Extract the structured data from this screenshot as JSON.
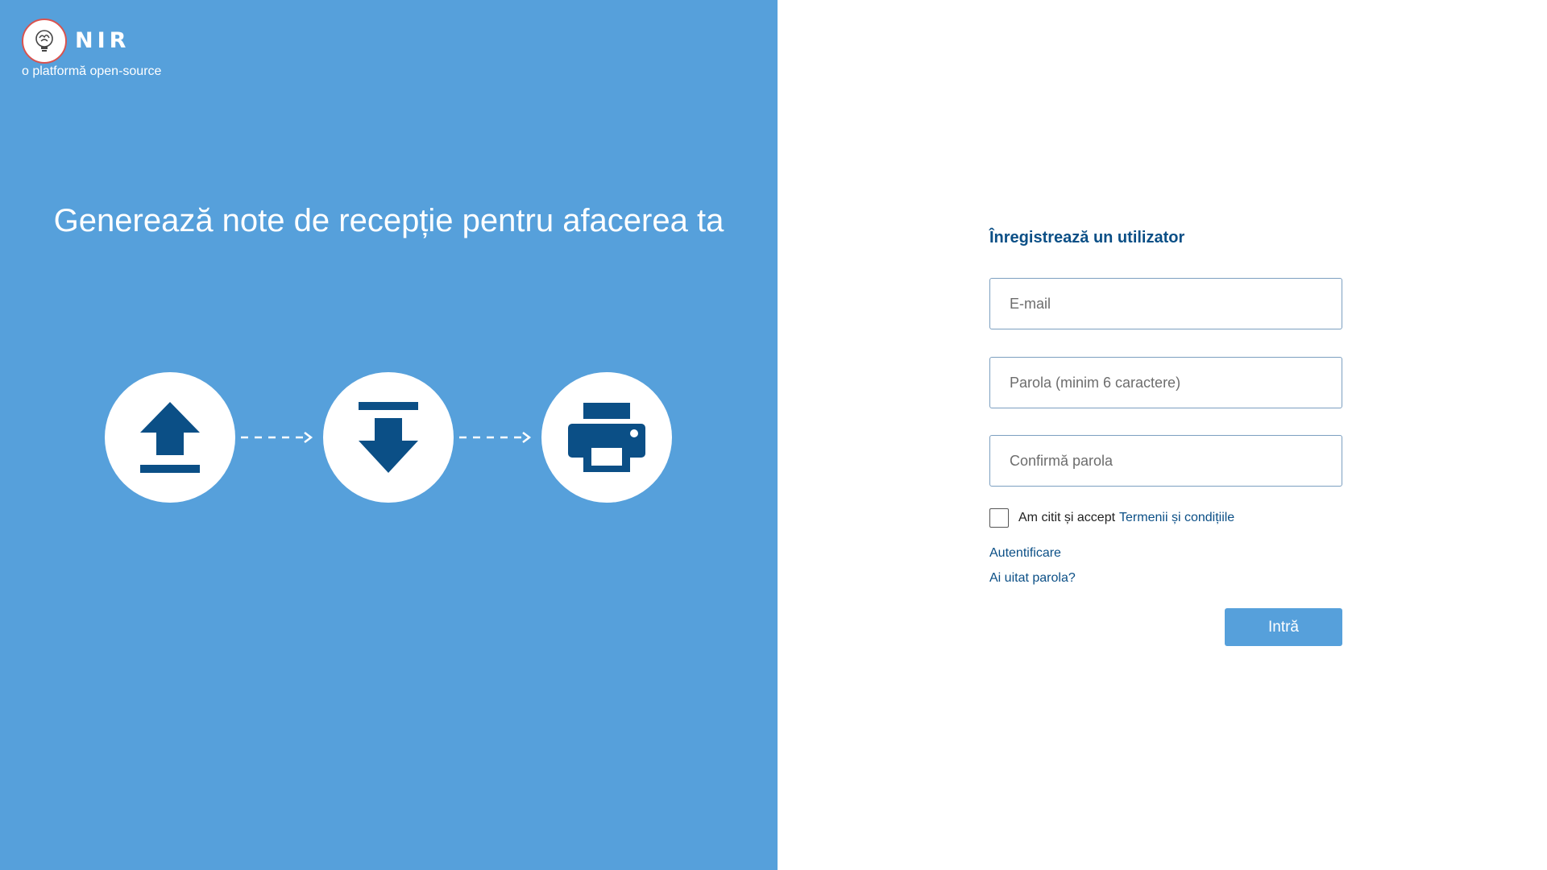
{
  "brand": {
    "name": "NIR",
    "tagline": "o platformă open-source",
    "logo_icon": "brain-lightbulb-icon",
    "logo_border_color": "#d9534f"
  },
  "hero": {
    "headline": "Generează note de recepție pentru afacerea ta",
    "background_color": "#56a0db",
    "steps": [
      {
        "icon": "upload-icon"
      },
      {
        "icon": "download-icon"
      },
      {
        "icon": "printer-icon"
      }
    ],
    "icon_color": "#0b4f86"
  },
  "form": {
    "title": "Înregistrează un utilizator",
    "email_placeholder": "E-mail",
    "password_placeholder": "Parola (minim 6 caractere)",
    "confirm_placeholder": "Confirmă parola",
    "terms_text": "Am citit și accept",
    "terms_link": "Termenii și condițiile",
    "login_link": "Autentificare",
    "forgot_link": "Ai uitat parola?",
    "submit_label": "Intră",
    "accent_color": "#0b4f86"
  }
}
